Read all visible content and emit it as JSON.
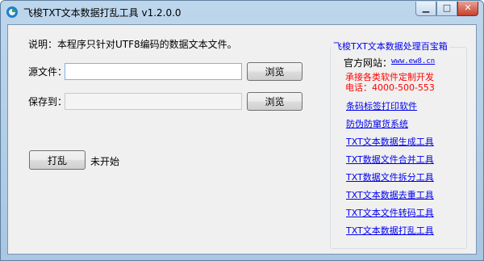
{
  "window": {
    "title": "飞梭TXT文本数据打乱工具 v1.2.0.0"
  },
  "main": {
    "description": "说明：本程序只针对UTF8编码的数据文本文件。",
    "source_label": "源文件：",
    "source_value": "",
    "save_label": "保存到：",
    "save_value": "",
    "browse_label": "浏览",
    "shuffle_label": "打乱",
    "status_text": "未开始"
  },
  "toolbox": {
    "title": "飞梭TXT文本数据处理百宝箱",
    "site_label": "官方网站：",
    "site_url": "www.ew8.cn",
    "promo_line1": "承接各类软件定制开发",
    "promo_line2": "电话：4000-500-553",
    "links": [
      "条码标签打印软件",
      "防伪防窜货系统",
      "TXT文本数据生成工具",
      "TXT数据文件合并工具",
      "TXT数据文件拆分工具",
      "TXT文本数据去重工具",
      "TXT文本文件转码工具",
      "TXT文本数据打乱工具"
    ]
  },
  "colors": {
    "link": "#0000ee",
    "promo": "#ff0000",
    "titlebar": "#bdd6ec"
  },
  "icons": {
    "app": "app-icon",
    "minimize": "minimize-icon",
    "maximize": "maximize-icon",
    "close": "close-icon"
  }
}
